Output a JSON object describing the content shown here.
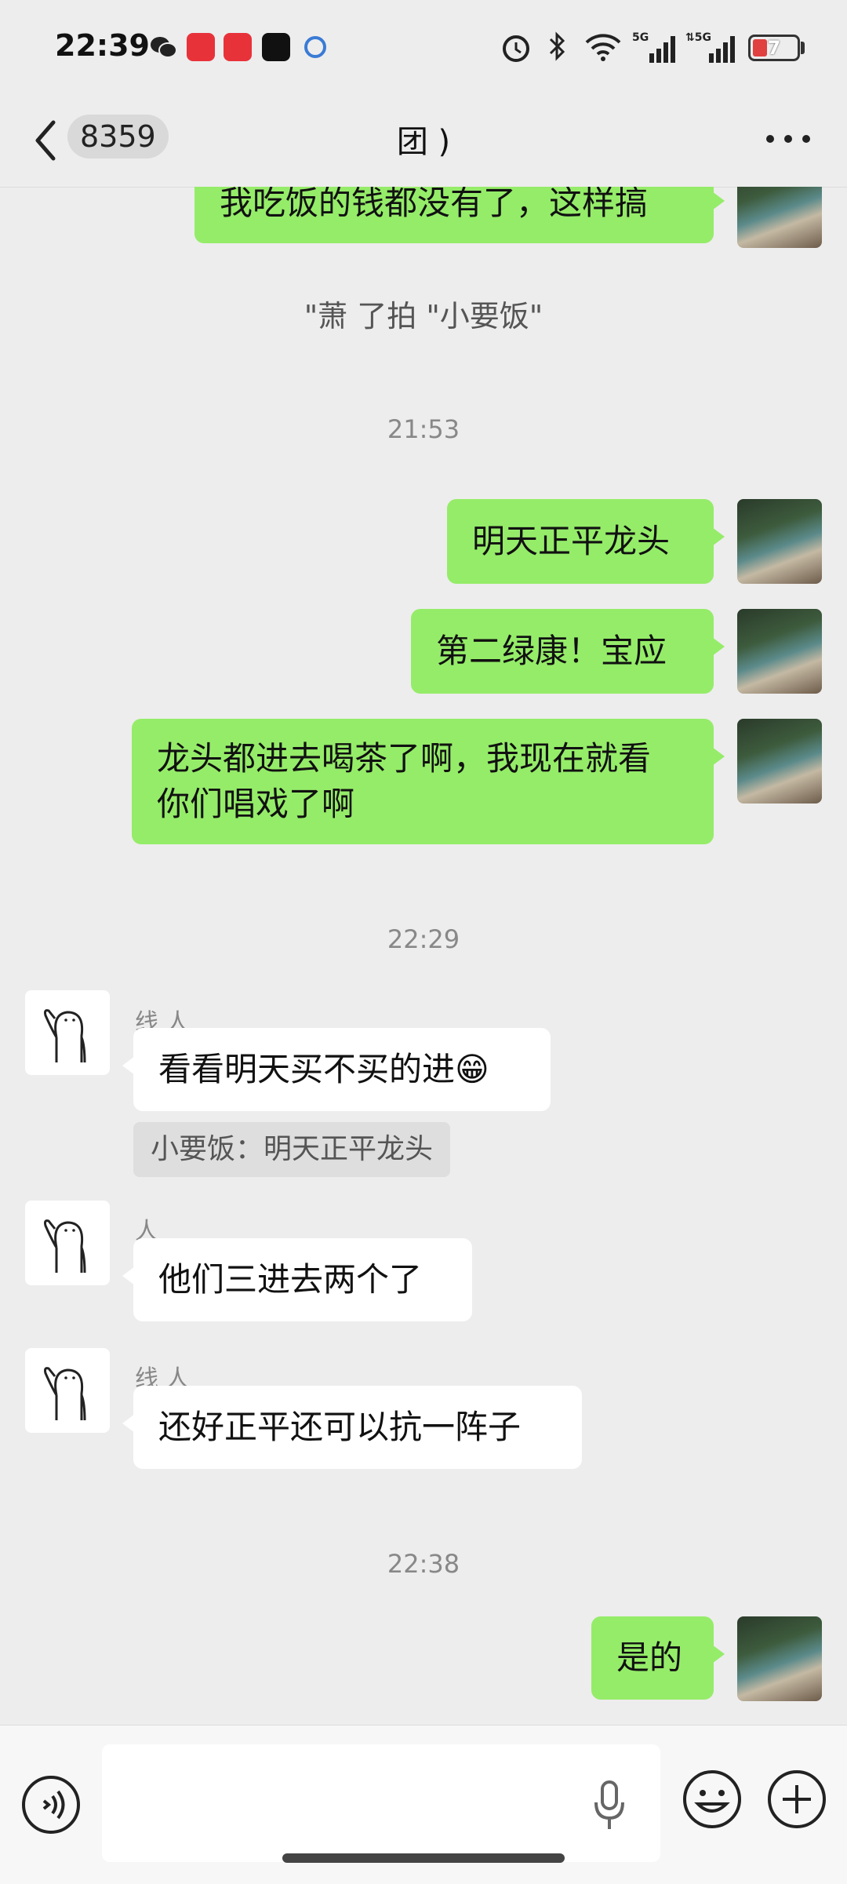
{
  "status_bar": {
    "time": "22:39",
    "battery": "7",
    "icons": [
      "wechat-icon",
      "app-icon",
      "toutiao-icon",
      "tiktok-icon",
      "app-icon",
      "alarm-icon",
      "bluetooth-icon",
      "wifi-icon",
      "signal-5g-icon",
      "signal-5g-icon",
      "battery-icon"
    ]
  },
  "nav": {
    "unread_count": "8359",
    "title": "团         )"
  },
  "messages": {
    "m1": "我吃饭的钱都没有了，这样搞",
    "sys1": "\"萧     了拍 \"小要饭\"",
    "t1": "21:53",
    "m2": "明天正平龙头",
    "m3": "第二绿康！宝应",
    "m4_line1": "龙头都进去喝茶了啊，我现在就看",
    "m4_line2": "你们唱戏了啊",
    "t2": "22:29",
    "sender1": "线   人",
    "m5": "看看明天买不买的进😁",
    "quote1": "小要饭：明天正平龙头",
    "sender2": "   人",
    "m6": "他们三进去两个了",
    "sender3": "线   人",
    "m7": "还好正平还可以抗一阵子",
    "t3": "22:38",
    "m8": "是的"
  },
  "input": {
    "placeholder": ""
  },
  "colors": {
    "my_bubble": "#95ec69",
    "other_bubble": "#ffffff",
    "background": "#ededed"
  }
}
